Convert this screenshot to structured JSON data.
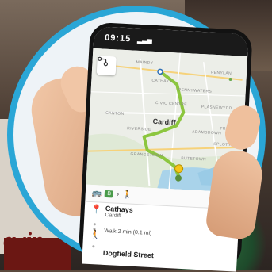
{
  "background": {
    "store_sign_text": "ewin"
  },
  "status_bar": {
    "time": "09:15",
    "signal": "▂▃▅"
  },
  "map": {
    "city": "Cardiff",
    "labels": [
      "MAINDY",
      "CATHAYS",
      "PENYLAN",
      "PENNYWATERS",
      "PLASNEWYDD",
      "CIVIC CENTRE",
      "RIVERSIDE",
      "GRANGETOWN",
      "BUTETOWN",
      "ADAMSDOWN",
      "TREMORFA",
      "CANTON",
      "SPLOTT"
    ]
  },
  "trip": {
    "bus_badge": "B"
  },
  "steps": {
    "from_title": "Cathays",
    "from_sub": "Cardiff",
    "walk": "Walk 2 min (0.1 mi)",
    "to_title": "Dogfield Street"
  },
  "colors": {
    "route": "#8cc63f",
    "ring": "#2aa6d6"
  }
}
